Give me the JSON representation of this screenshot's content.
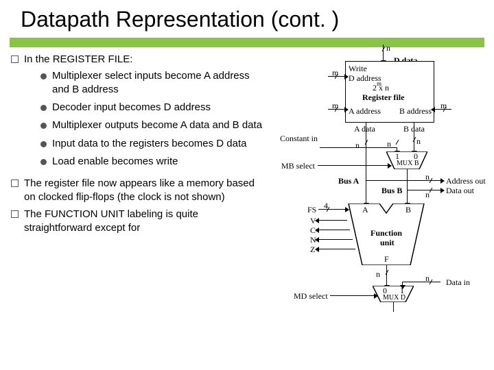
{
  "title": "Datapath Representation (cont. )",
  "left": {
    "h1": "In the REGISTER FILE:",
    "bullets": [
      "Multiplexer select inputs become A address and B address",
      "Decoder input becomes D address",
      "Multiplexer outputs become A data and B data",
      "Input data to the registers becomes D data",
      "Load enable becomes write"
    ],
    "p2": "The register file now appears like a memory based on clocked flip-flops (the clock is not shown)",
    "p3": "The FUNCTION UNIT labeling is quite straightforward except for"
  },
  "diag": {
    "n": "n",
    "m": "m",
    "d_data": "D data",
    "write": "Write",
    "d_addr": "D address",
    "reg1": "2  x n",
    "reg1sup": "m",
    "reg2": "Register file",
    "a_addr": "A address",
    "b_addr": "B address",
    "a_data": "A data",
    "b_data": "B data",
    "const": "Constant in",
    "mb_sel": "MB select",
    "muxb1": "1",
    "muxb0": "0",
    "muxb": "MUX B",
    "busA": "Bus A",
    "busB": "Bus B",
    "addr_out": "Address out",
    "data_out": "Data out",
    "fs": "FS",
    "four": "4",
    "A": "A",
    "B": "B",
    "V": "V",
    "C": "C",
    "N": "N",
    "Z": "Z",
    "func": "Function",
    "unit": "unit",
    "F": "F",
    "md_sel": "MD select",
    "muxd0": "0",
    "muxd1": "1",
    "muxd": "MUX D",
    "data_in": "Data in"
  }
}
